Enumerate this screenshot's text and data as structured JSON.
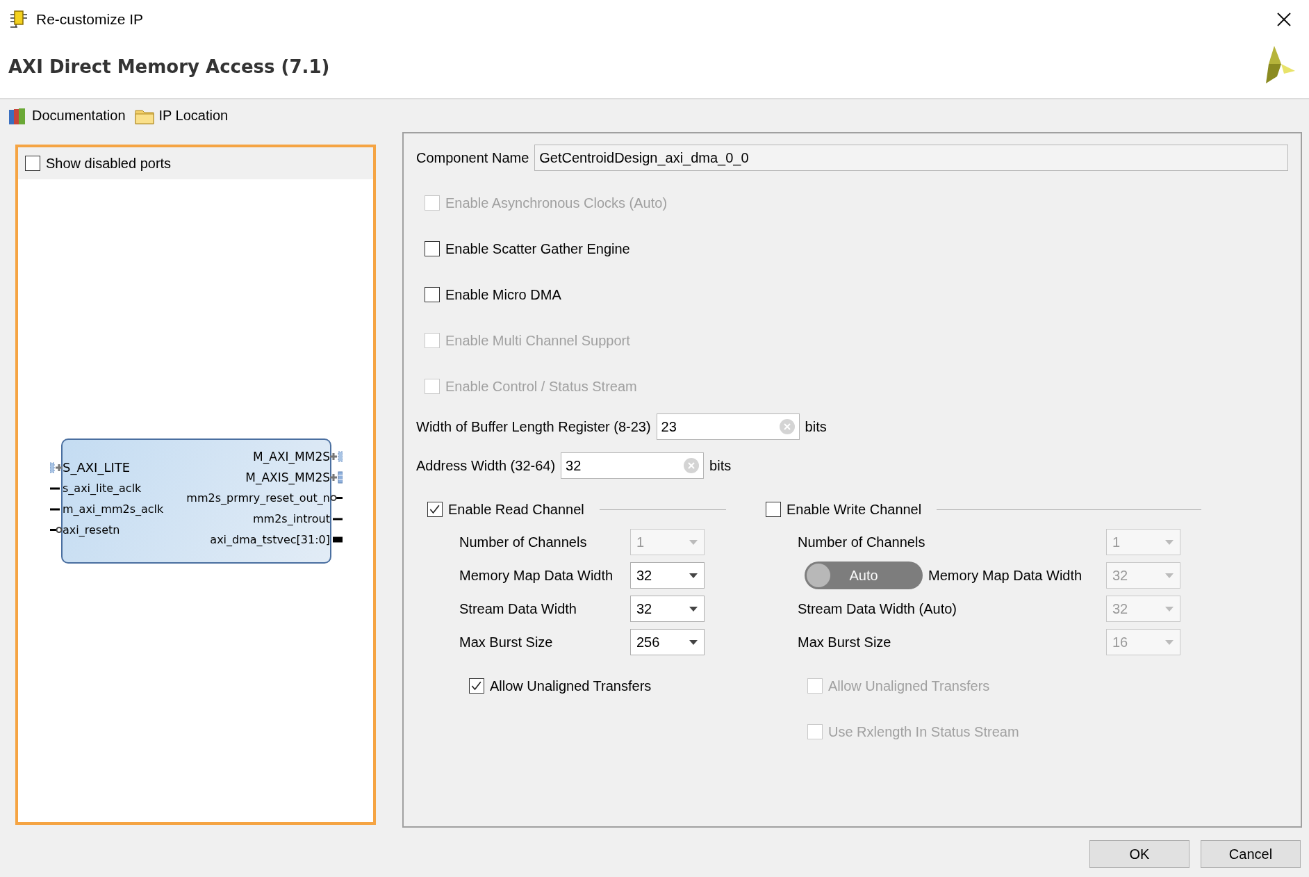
{
  "window": {
    "title": "Re-customize IP"
  },
  "header": {
    "title": "AXI Direct Memory Access (7.1)"
  },
  "toolbar": [
    {
      "label": "Documentation",
      "kind": "books"
    },
    {
      "label": "IP Location",
      "kind": "folder"
    }
  ],
  "left_panel": {
    "show_disabled_ports": {
      "label": "Show disabled ports",
      "checked": false
    },
    "block": {
      "left_ports": [
        {
          "name": "S_AXI_LITE",
          "kind": "bus"
        },
        {
          "name": "s_axi_lite_aclk",
          "kind": "wire"
        },
        {
          "name": "m_axi_mm2s_aclk",
          "kind": "wire"
        },
        {
          "name": "axi_resetn",
          "kind": "inverted"
        }
      ],
      "right_ports": [
        {
          "name": "M_AXI_MM2S",
          "kind": "bus"
        },
        {
          "name": "M_AXIS_MM2S",
          "kind": "stream"
        },
        {
          "name": "mm2s_prmry_reset_out_n",
          "kind": "inverted"
        },
        {
          "name": "mm2s_introut",
          "kind": "wire"
        },
        {
          "name": "axi_dma_tstvec[31:0]",
          "kind": "vector"
        }
      ]
    }
  },
  "component_name": {
    "label": "Component Name",
    "value": "GetCentroidDesign_axi_dma_0_0"
  },
  "options": [
    {
      "label": "Enable Asynchronous Clocks (Auto)",
      "checked": false,
      "disabled": true
    },
    {
      "label": "Enable Scatter Gather Engine",
      "checked": false,
      "disabled": false
    },
    {
      "label": "Enable Micro DMA",
      "checked": false,
      "disabled": false
    },
    {
      "label": "Enable Multi Channel Support",
      "checked": false,
      "disabled": true
    },
    {
      "label": "Enable Control / Status Stream",
      "checked": false,
      "disabled": true
    }
  ],
  "fields": [
    {
      "label": "Width of Buffer Length Register (8-23)",
      "value": "23",
      "unit": "bits"
    },
    {
      "label": "Address Width (32-64)",
      "value": "32",
      "unit": "bits"
    }
  ],
  "channels": [
    {
      "label": "Enable Read Channel",
      "checked": true,
      "settings": [
        {
          "label": "Number of Channels",
          "value": "1",
          "disabled": true
        },
        {
          "label": "Memory Map Data Width",
          "value": "32",
          "disabled": false
        },
        {
          "label": "Stream Data Width",
          "value": "32",
          "disabled": false
        },
        {
          "label": "Max Burst Size",
          "value": "256",
          "disabled": false
        }
      ],
      "options": [
        {
          "label": "Allow Unaligned Transfers",
          "checked": true,
          "disabled": false
        }
      ]
    },
    {
      "label": "Enable Write Channel",
      "checked": false,
      "settings": [
        {
          "label": "Number of Channels",
          "value": "1",
          "disabled": true
        },
        {
          "label": "Memory Map Data Width",
          "value": "32",
          "disabled": true,
          "toggle": {
            "label": "Auto",
            "on": false
          }
        },
        {
          "label": "Stream Data Width (Auto)",
          "value": "32",
          "disabled": true
        },
        {
          "label": "Max Burst Size",
          "value": "16",
          "disabled": true
        }
      ],
      "options": [
        {
          "label": "Allow Unaligned Transfers",
          "checked": false,
          "disabled": true
        },
        {
          "label": "Use Rxlength In Status Stream",
          "checked": false,
          "disabled": true
        }
      ]
    }
  ],
  "buttons": [
    {
      "label": "OK"
    },
    {
      "label": "Cancel"
    }
  ]
}
